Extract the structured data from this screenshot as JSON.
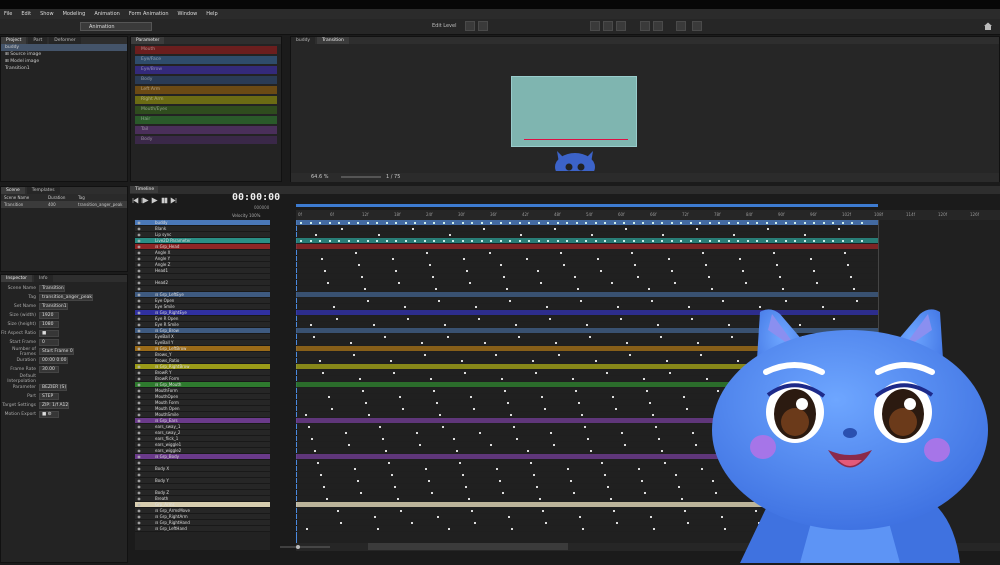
{
  "menu": [
    "File",
    "Edit",
    "Show",
    "Modeling",
    "Animation",
    "Form Animation",
    "Window",
    "Help"
  ],
  "toolbar": {
    "mode": "Animation",
    "edit_level": "Edit Level"
  },
  "left_tabs": [
    "Project",
    "Part",
    "Deformer"
  ],
  "project_tree": [
    {
      "label": "buddy",
      "selected": true
    },
    {
      "label": "⊞ Source image",
      "selected": false
    },
    {
      "label": "⊞ Model image",
      "selected": false
    },
    {
      "label": "Transition1",
      "selected": false
    }
  ],
  "parameter_panel": {
    "title": "Parameter",
    "bars": [
      {
        "label": "Mouth",
        "color": "#6b1e1e"
      },
      {
        "label": "Eye/Face",
        "color": "#2f4c6b"
      },
      {
        "label": "Eye/Brow",
        "color": "#342a7a"
      },
      {
        "label": "Body",
        "color": "#2a3b55"
      },
      {
        "label": "Left Arm",
        "color": "#6b4a14"
      },
      {
        "label": "Right Arm",
        "color": "#6b6b14"
      },
      {
        "label": "Mouth/Eyes",
        "color": "#2f4c1e"
      },
      {
        "label": "Hair",
        "color": "#2a5a2a"
      },
      {
        "label": "Tail",
        "color": "#4a2f5a"
      },
      {
        "label": "Body",
        "color": "#3a2848"
      }
    ]
  },
  "viewer_tabs": [
    "buddy",
    "Transition"
  ],
  "viewer": {
    "zoom": "64.6 %",
    "readout": "1 / 75"
  },
  "scene_panel": {
    "tabs": [
      "Scene",
      "Templates"
    ],
    "columns": [
      "Scene Name",
      "Duration",
      "Tag"
    ],
    "rows": [
      {
        "name": "Transition",
        "duration": "400",
        "tag": "transition_anger_peak"
      }
    ]
  },
  "inspector": {
    "tabs": [
      "Inspector",
      "Info"
    ],
    "fields": [
      {
        "k": "Scene Name",
        "v": "Transition"
      },
      {
        "k": "Tag",
        "v": "transition_anger_peak"
      },
      {
        "k": "Set Name",
        "v": "Transition1"
      },
      {
        "k": "Size (width)",
        "v": "1920"
      },
      {
        "k": "Size (height)",
        "v": "1080"
      },
      {
        "k": "Fit Aspect Ratio",
        "v": "■"
      },
      {
        "k": "Start Frame",
        "v": "0"
      },
      {
        "k": "Number of Frames",
        "v": "Start Frame 0"
      },
      {
        "k": "Duration",
        "v": "00:00 0:00"
      },
      {
        "k": "Frame Rate",
        "v": "30.00"
      },
      {
        "k": "Default Interpolation",
        "v": ""
      },
      {
        "k": "Parameter",
        "v": "BEZIER (S)"
      },
      {
        "k": "Part",
        "v": "STEP"
      },
      {
        "k": "Target Settings",
        "v": "ZIP: 1/f A12"
      },
      {
        "k": "Motion Export",
        "v": "■ ⚙"
      }
    ]
  },
  "timeline": {
    "title": "Timeline",
    "timecode": "00:00:00",
    "timecode_sub": "000000",
    "velocity_label": "Velocity",
    "velocity_value": "100%",
    "ruler_ticks": [
      "0f",
      "6f",
      "12f",
      "18f",
      "24f",
      "30f",
      "36f",
      "42f",
      "48f",
      "54f",
      "60f",
      "66f",
      "72f",
      "78f",
      "84f",
      "90f",
      "96f",
      "102f",
      "108f",
      "114f",
      "120f",
      "126f",
      "132f",
      "138f"
    ],
    "rows": [
      {
        "label": "buddy",
        "color": "#4a78b8"
      },
      {
        "label": "Blank",
        "color": "#262626"
      },
      {
        "label": "Lip sync",
        "color": "#262626"
      },
      {
        "label": "Live2D Parameter",
        "color": "#2a8e85"
      },
      {
        "label": "⊟ Grp_Head",
        "color": "#8e2525"
      },
      {
        "label": "Angle X",
        "color": "#262626"
      },
      {
        "label": "Angle Y",
        "color": "#262626"
      },
      {
        "label": "Angle Z",
        "color": "#262626"
      },
      {
        "label": "Head1",
        "color": "#262626"
      },
      {
        "label": "",
        "color": "#262626"
      },
      {
        "label": "Head2",
        "color": "#262626"
      },
      {
        "label": "",
        "color": "#262626"
      },
      {
        "label": "⊟ Grp_LeftEye",
        "color": "#3e5a80"
      },
      {
        "label": "Eye Open",
        "color": "#262626"
      },
      {
        "label": "Eye Smile",
        "color": "#262626"
      },
      {
        "label": "⊟ Grp_RightEye",
        "color": "#3030a0"
      },
      {
        "label": "Eye R Open",
        "color": "#262626"
      },
      {
        "label": "Eye R Smile",
        "color": "#262626"
      },
      {
        "label": "⊟ Grp_Brow",
        "color": "#3e5a80"
      },
      {
        "label": "EyeBall X",
        "color": "#262626"
      },
      {
        "label": "EyeBall Y",
        "color": "#262626"
      },
      {
        "label": "⊟ Grp_LeftBrow",
        "color": "#9a6a18"
      },
      {
        "label": "Brows_Y",
        "color": "#262626"
      },
      {
        "label": "Brows_Ratio",
        "color": "#262626"
      },
      {
        "label": "⊟ Grp_RightBrow",
        "color": "#9a9a18"
      },
      {
        "label": "BrowR Y",
        "color": "#262626"
      },
      {
        "label": "BrowR Form",
        "color": "#262626"
      },
      {
        "label": "⊟ Grp_Mouth",
        "color": "#2e7a2e"
      },
      {
        "label": "MouthForm",
        "color": "#262626"
      },
      {
        "label": "MouthOpen",
        "color": "#262626"
      },
      {
        "label": "Mouth Form",
        "color": "#262626"
      },
      {
        "label": "Mouth Open",
        "color": "#262626"
      },
      {
        "label": "MouthSmile",
        "color": "#262626"
      },
      {
        "label": "⊟ Grp_Ears",
        "color": "#6a3a8a"
      },
      {
        "label": "ears_sway_1",
        "color": "#262626"
      },
      {
        "label": "ears_sway_2",
        "color": "#262626"
      },
      {
        "label": "ears_flick_1",
        "color": "#262626"
      },
      {
        "label": "ears_wiggle1",
        "color": "#262626"
      },
      {
        "label": "ears_wiggle2",
        "color": "#262626"
      },
      {
        "label": "⊟ Grp_Body",
        "color": "#6a3a8a"
      },
      {
        "label": "",
        "color": "#262626"
      },
      {
        "label": "Body X",
        "color": "#262626"
      },
      {
        "label": "",
        "color": "#262626"
      },
      {
        "label": "Body Y",
        "color": "#262626"
      },
      {
        "label": "",
        "color": "#262626"
      },
      {
        "label": "Body Z",
        "color": "#262626"
      },
      {
        "label": "Breath",
        "color": "#262626"
      },
      {
        "label": "Grp_Arms",
        "color": "#d8ceb0"
      },
      {
        "label": "⊟ Grp_ArmsMove",
        "color": "#262626"
      },
      {
        "label": "⊟ Grp_RightArm",
        "color": "#262626"
      },
      {
        "label": "⊟ Grp_RightHand",
        "color": "#262626"
      },
      {
        "label": "⊟ Grp_LeftHand",
        "color": "#262626"
      }
    ]
  },
  "colors": {
    "accent_blue": "#4a78b8",
    "teal": "#2a8e85",
    "character_blue": "#4f8cf0"
  }
}
